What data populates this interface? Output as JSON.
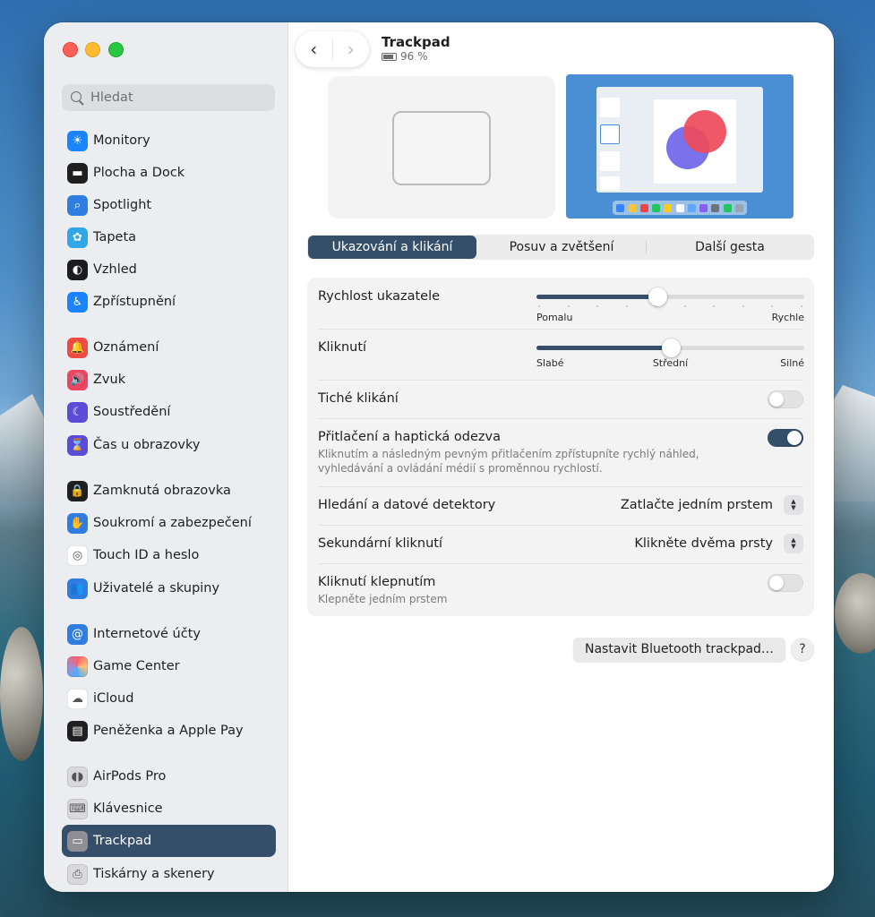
{
  "window": {
    "title": "Trackpad",
    "battery": "96 %"
  },
  "sidebar": {
    "search_placeholder": "Hledat",
    "items": [
      {
        "label": "Monitory",
        "icon": "sun-icon",
        "color": "#1a84ff"
      },
      {
        "label": "Plocha a Dock",
        "icon": "dock-icon",
        "color": "#1f1f1f"
      },
      {
        "label": "Spotlight",
        "icon": "magnifier-icon",
        "color": "#2f7de0"
      },
      {
        "label": "Tapeta",
        "icon": "flower-icon",
        "color": "#31a6e8"
      },
      {
        "label": "Vzhled",
        "icon": "appearance-icon",
        "color": "#1c1c1e"
      },
      {
        "label": "Zpřístupnění",
        "icon": "accessibility-icon",
        "color": "#1a84ff"
      },
      {
        "label": "Oznámení",
        "icon": "bell-icon",
        "color": "#ef4a43"
      },
      {
        "label": "Zvuk",
        "icon": "speaker-icon",
        "color": "#ec4561"
      },
      {
        "label": "Soustředění",
        "icon": "moon-icon",
        "color": "#5b4bd9"
      },
      {
        "label": "Čas u obrazovky",
        "icon": "hourglass-icon",
        "color": "#5b4bd9"
      },
      {
        "label": "Zamknutá obrazovka",
        "icon": "lock-icon",
        "color": "#1f1f1f"
      },
      {
        "label": "Soukromí a zabezpečení",
        "icon": "hand-icon",
        "color": "#2f7de0"
      },
      {
        "label": "Touch ID a heslo",
        "icon": "fingerprint-icon",
        "color": "#ffffff"
      },
      {
        "label": "Uživatelé a skupiny",
        "icon": "users-icon",
        "color": "#2f7de0"
      },
      {
        "label": "Internetové účty",
        "icon": "at-icon",
        "color": "#2f7de0"
      },
      {
        "label": "Game Center",
        "icon": "game-center-icon",
        "color": "#ffffff"
      },
      {
        "label": "iCloud",
        "icon": "cloud-icon",
        "color": "#ffffff"
      },
      {
        "label": "Peněženka a Apple Pay",
        "icon": "wallet-icon",
        "color": "#1f1f1f"
      },
      {
        "label": "AirPods Pro",
        "icon": "airpods-icon",
        "color": "#d9d9dc"
      },
      {
        "label": "Klávesnice",
        "icon": "keyboard-icon",
        "color": "#d9d9dc"
      },
      {
        "label": "Trackpad",
        "icon": "trackpad-icon",
        "color": "#8e8e93",
        "active": true
      },
      {
        "label": "Tiskárny a skenery",
        "icon": "printer-icon",
        "color": "#d9d9dc"
      }
    ]
  },
  "tabs": [
    {
      "label": "Ukazování a klikání",
      "selected": true
    },
    {
      "label": "Posuv a zvětšení",
      "selected": false
    },
    {
      "label": "Další gesta",
      "selected": false
    }
  ],
  "settings": {
    "pointer_speed": {
      "label": "Rychlost ukazatele",
      "min_label": "Pomalu",
      "max_label": "Rychle",
      "value": 0.45
    },
    "click": {
      "label": "Kliknutí",
      "left_label": "Slabé",
      "mid_label": "Střední",
      "right_label": "Silné",
      "value": 0.5
    },
    "silent_click": {
      "label": "Tiché klikání",
      "on": false
    },
    "force_click": {
      "label": "Přitlačení a haptická odezva",
      "desc": "Kliknutím a následným pevným přitlačením zpřístupníte rychlý náhled, vyhledávání a ovládání médií s proměnnou rychlostí.",
      "on": true
    },
    "lookup": {
      "label": "Hledání a datové detektory",
      "value": "Zatlačte jedním prstem"
    },
    "secondary_click": {
      "label": "Sekundární kliknutí",
      "value": "Klikněte dvěma prsty"
    },
    "tap_to_click": {
      "label": "Kliknutí klepnutím",
      "desc": "Klepněte jedním prstem",
      "on": false
    }
  },
  "footer": {
    "bt_button": "Nastavit Bluetooth trackpad…",
    "help": "?"
  },
  "colors": {
    "accent": "#354f6a",
    "close": "#fe5f57",
    "minimize": "#febc2e",
    "maximize": "#28c840"
  }
}
